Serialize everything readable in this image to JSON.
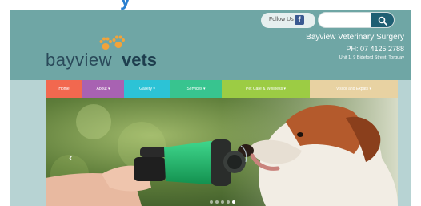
{
  "header": {
    "follow_label": "Follow Us",
    "facebook_icon": "facebook-icon",
    "search_placeholder": "",
    "search_icon": "search-icon",
    "logo_word_a": "bayview",
    "logo_word_b": "vets",
    "practice_name": "Bayview Veterinary Surgery",
    "phone": "PH: 07 4125 2788",
    "address": "Unit 1, 9 Bideford Street, Torquay"
  },
  "nav": {
    "items": [
      {
        "label": "Home",
        "color": "#f2684f"
      },
      {
        "label": "About ▾",
        "color": "#a862b2"
      },
      {
        "label": "Gallery ▾",
        "color": "#2cc3d6"
      },
      {
        "label": "Services ▾",
        "color": "#38c48f"
      },
      {
        "label": "Pet Care & Wellness ▾",
        "color": "#9ccc44"
      },
      {
        "label": "Visitor and Expats ▾",
        "color": "#e8d2a2"
      }
    ]
  },
  "hero": {
    "prev_icon": "chevron-left-icon",
    "slide_count": 5,
    "active_slide": 5
  },
  "colors": {
    "header_bg": "#6fa6a5",
    "page_bg": "#b7d3d3",
    "search_button": "#1f5f73",
    "logo_paw": "#f2a33a"
  }
}
